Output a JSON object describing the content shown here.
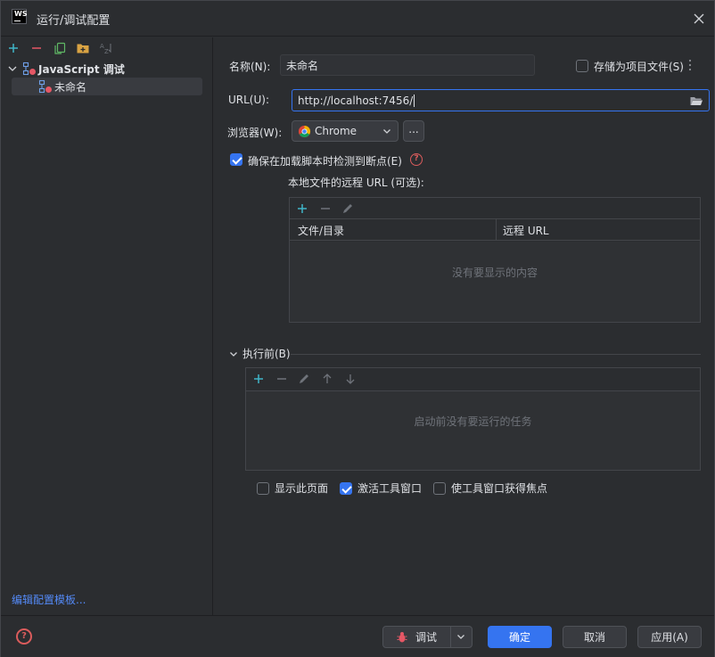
{
  "window": {
    "title": "运行/调试配置",
    "app_logo_text": "WS"
  },
  "left_panel": {
    "toolbar_icons": [
      "add-icon",
      "remove-icon",
      "copy-icon",
      "new-folder-icon",
      "sort-alphabetically-icon"
    ],
    "tree": {
      "root_label": "JavaScript 调试",
      "child_label": "未命名"
    },
    "edit_templates_link": "编辑配置模板..."
  },
  "form": {
    "name_label": "名称(N):",
    "name_value": "未命名",
    "store_as_project_file_label": "存储为项目文件(S)",
    "store_as_project_file_checked": false,
    "url_label": "URL(U):",
    "url_value": "http://localhost:7456/",
    "browser_label": "浏览器(W):",
    "browser_value": "Chrome",
    "browser_more_button": "...",
    "ensure_breakpoints_label": "确保在加载脚本时检测到断点(E)",
    "ensure_breakpoints_checked": true,
    "remote_urls_label": "本地文件的远程 URL (可选):",
    "remote_table": {
      "columns": [
        "文件/目录",
        "远程 URL"
      ],
      "empty_text": "没有要显示的内容"
    }
  },
  "before_launch": {
    "title": "执行前(B)",
    "empty_text": "启动前没有要运行的任务",
    "options": [
      {
        "label": "显示此页面",
        "checked": false
      },
      {
        "label": "激活工具窗口",
        "checked": true
      },
      {
        "label": "使工具窗口获得焦点",
        "checked": false
      }
    ]
  },
  "footer": {
    "debug_button": "调试",
    "ok_button": "确定",
    "cancel_button": "取消",
    "apply_button": "应用(A)"
  },
  "colors": {
    "background": "#2b2d30",
    "accent": "#3574f0",
    "link": "#548af7",
    "help": "#db5c5c"
  }
}
